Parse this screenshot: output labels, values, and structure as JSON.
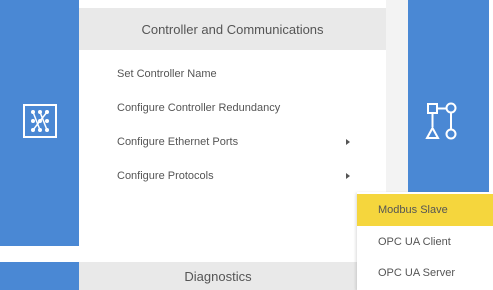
{
  "controller_card": {
    "title": "Controller and Communications",
    "items": [
      {
        "label": "Set Controller Name",
        "has_submenu": false
      },
      {
        "label": "Configure Controller Redundancy",
        "has_submenu": false
      },
      {
        "label": "Configure Ethernet Ports",
        "has_submenu": true
      },
      {
        "label": "Configure Protocols",
        "has_submenu": true
      }
    ],
    "left_icon": "network-matrix-icon",
    "right_icon": "signal-flow-icon",
    "tile_color": "#4a88d4"
  },
  "protocols_submenu": {
    "items": [
      {
        "label": "Modbus Slave",
        "highlighted": true
      },
      {
        "label": "OPC UA Client",
        "highlighted": false
      },
      {
        "label": "OPC UA Server",
        "highlighted": false
      }
    ],
    "highlight_color": "#f5d63d"
  },
  "diagnostics_card": {
    "title": "Diagnostics"
  }
}
